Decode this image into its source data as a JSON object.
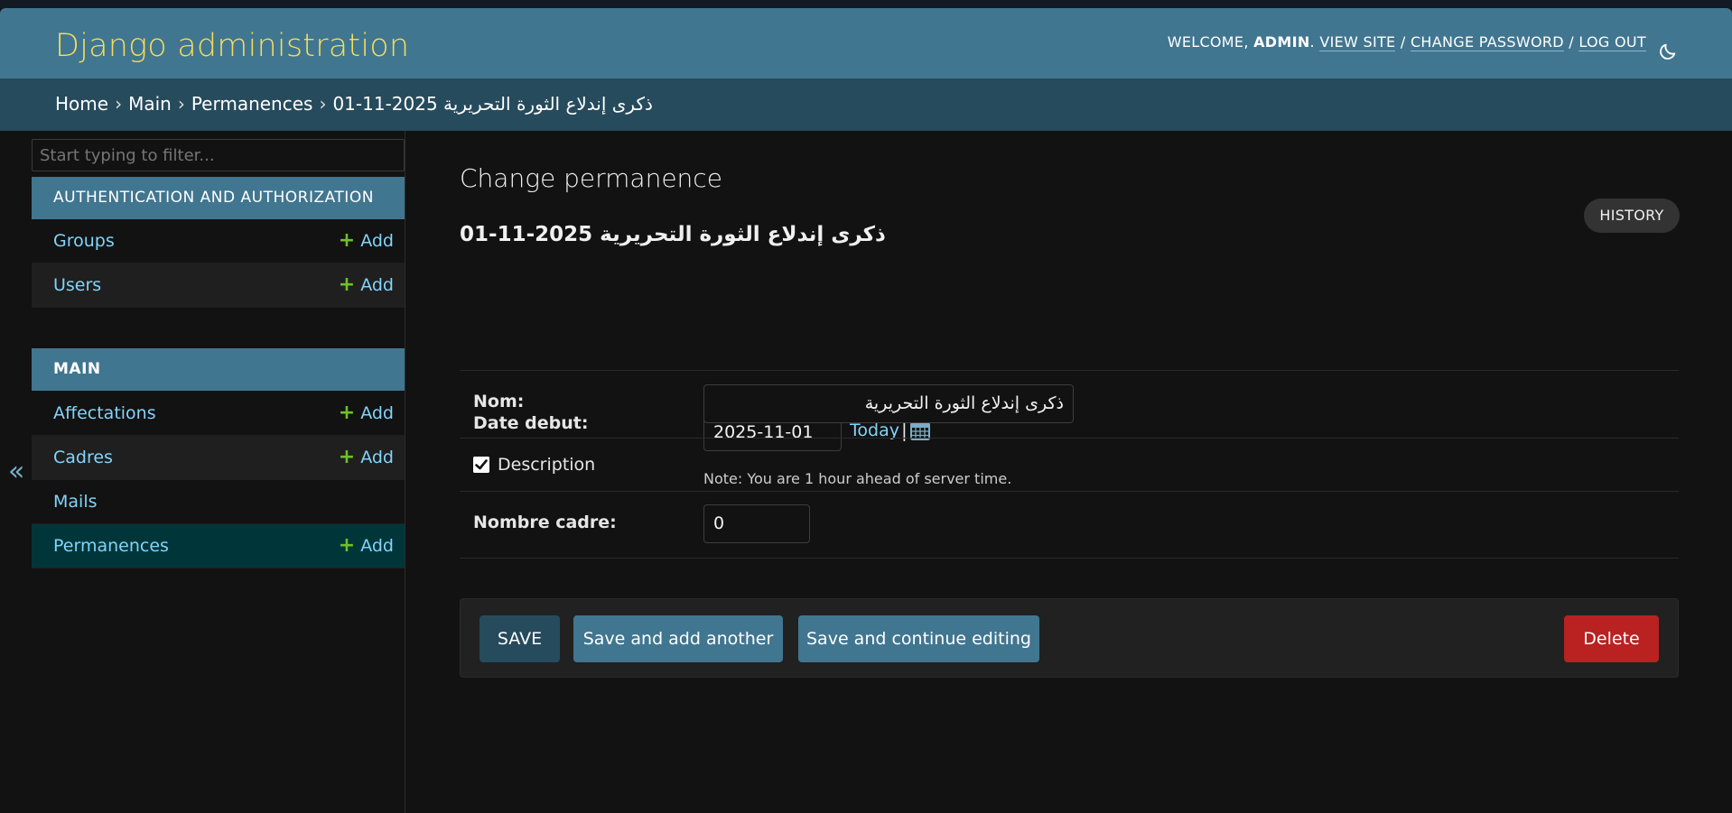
{
  "header": {
    "site_title": "Django administration",
    "welcome": "Welcome,",
    "username": "admin",
    "view_site": "View site",
    "change_password": "Change password",
    "log_out": "Log out",
    "separator": "/",
    "theme_icon": "moon-icon"
  },
  "breadcrumbs": {
    "home": "Home",
    "app": "Main",
    "model": "Permanences",
    "object": "ذكرى إندلاع الثورة التحريرية 2025-11-01",
    "separator": "›"
  },
  "sidebar": {
    "filter_placeholder": "Start typing to filter...",
    "collapse_icon": "«",
    "modules": [
      {
        "caption": "Authentication and Authorization",
        "models": [
          {
            "name": "Groups",
            "add": "Add"
          },
          {
            "name": "Users",
            "add": "Add"
          }
        ]
      },
      {
        "caption": "Main",
        "models": [
          {
            "name": "Affectations",
            "add": "Add"
          },
          {
            "name": "Cadres",
            "add": "Add"
          },
          {
            "name": "Mails",
            "add": ""
          },
          {
            "name": "Permanences",
            "add": "Add"
          }
        ]
      }
    ],
    "add_icon": "+"
  },
  "content": {
    "page_title": "Change permanence",
    "history_button": "History",
    "object_title": "ذكرى إندلاع الثورة التحريرية 2025-11-01",
    "fields": {
      "date_debut": {
        "label": "Date debut:",
        "value": "2025-11-01",
        "today_link": "Today",
        "pipe": "|",
        "calendar_icon": "calendar-icon",
        "note": "Note: You are 1 hour ahead of server time."
      },
      "nom": {
        "label": "Nom:",
        "value": "ذكرى إندلاع الثورة التحريرية"
      },
      "description": {
        "label": "Description",
        "checked": true
      },
      "nombre_cadre": {
        "label": "Nombre cadre:",
        "value": "0"
      }
    },
    "submit_row": {
      "save": "Save",
      "save_add_another": "Save and add another",
      "save_continue": "Save and continue editing",
      "delete": "Delete"
    }
  },
  "colors": {
    "header_bg": "#417690",
    "breadcrumbs_bg": "#264b5d",
    "brand_yellow": "#f5dd5d",
    "link_blue": "#81d4fa",
    "add_green": "#70bf2b",
    "delete_red": "#ba2121",
    "current_row": "#00363a"
  }
}
